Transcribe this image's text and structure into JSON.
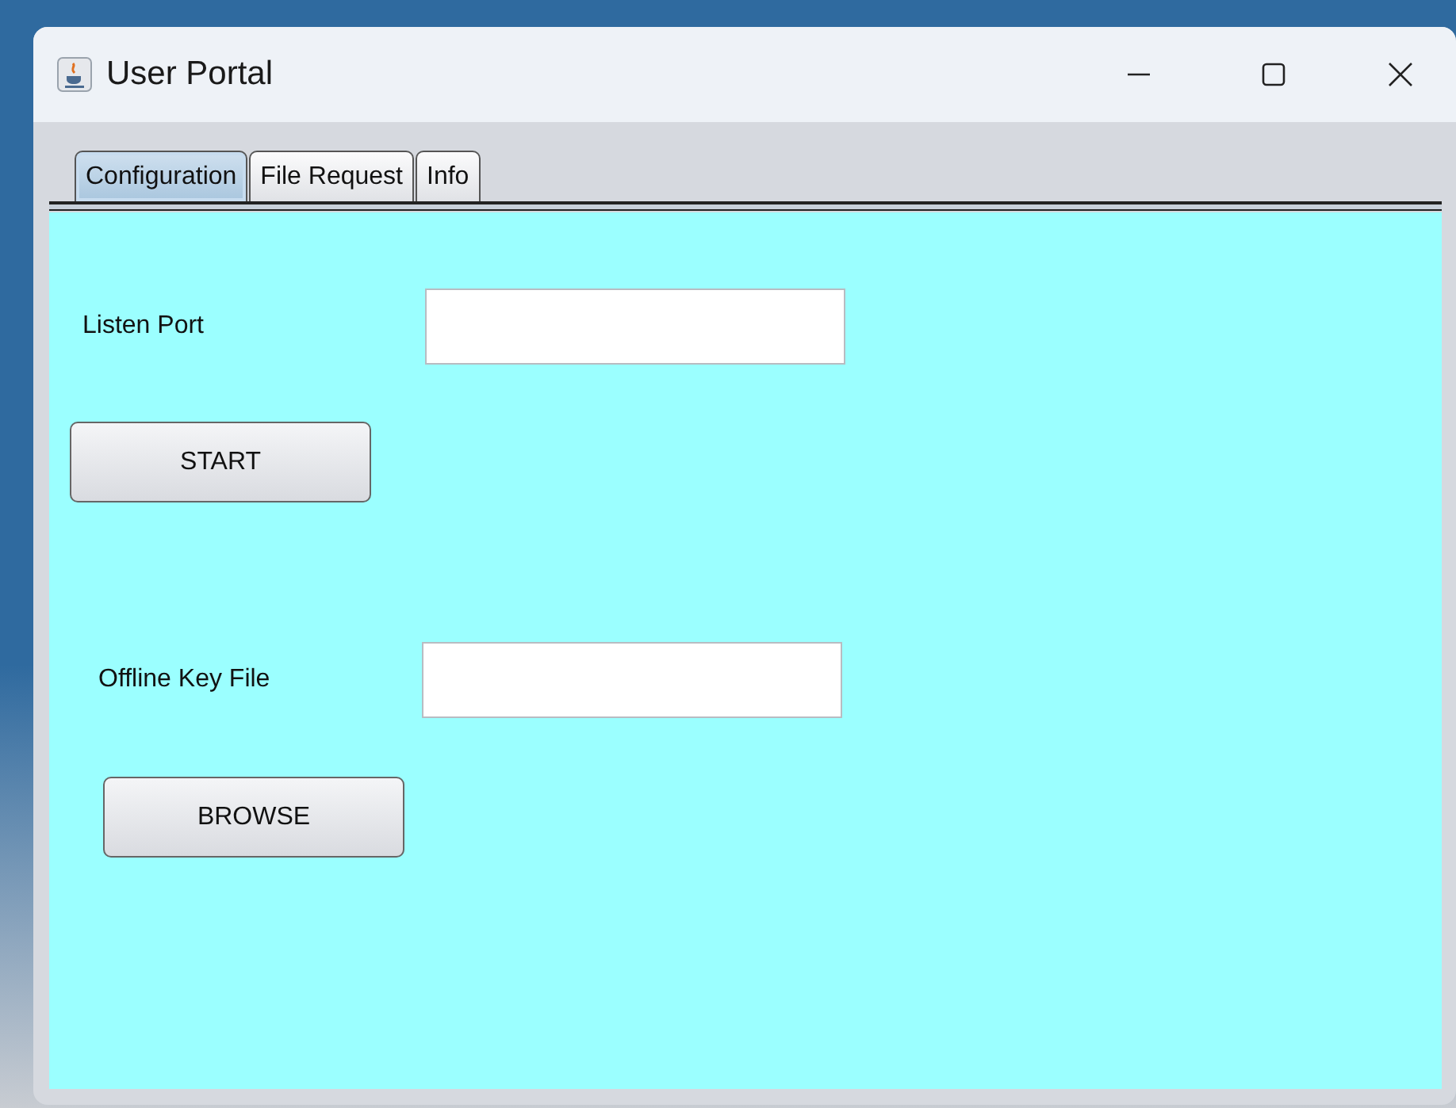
{
  "window": {
    "title": "User Portal"
  },
  "tabs": [
    {
      "label": "Configuration",
      "selected": true
    },
    {
      "label": "File Request",
      "selected": false
    },
    {
      "label": "Info",
      "selected": false
    }
  ],
  "form": [
    {
      "kind": "field",
      "label": "Listen Port"
    },
    {
      "kind": "button",
      "label": "START"
    },
    {
      "kind": "field",
      "label": "Offline Key File"
    },
    {
      "kind": "button",
      "label": "BROWSE"
    }
  ]
}
